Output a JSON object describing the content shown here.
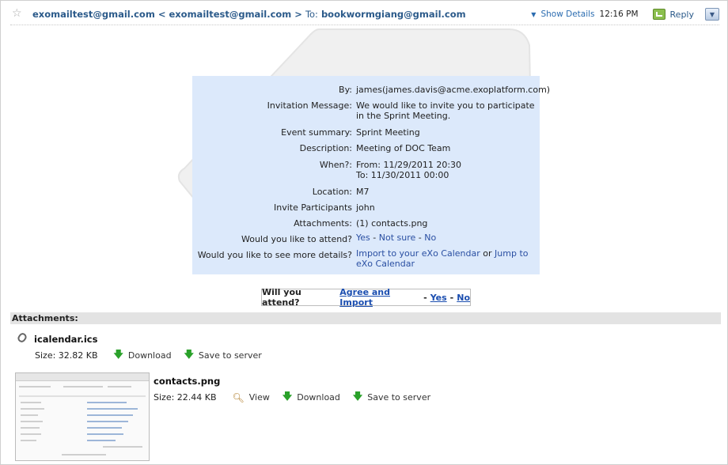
{
  "header": {
    "from": "exomailtest@gmail.com < exomailtest@gmail.com >",
    "to_label": "To:",
    "to": "bookwormgiang@gmail.com",
    "show_details": "Show Details",
    "time": "12:16 PM",
    "reply": "Reply"
  },
  "invite": {
    "rows": [
      {
        "label": "By:",
        "value": "james(james.davis@acme.exoplatform.com)"
      },
      {
        "label": "Invitation Message:",
        "value": "We would like to invite you to participate in the Sprint Meeting."
      },
      {
        "label": "Event summary:",
        "value": "Sprint Meeting"
      },
      {
        "label": "Description:",
        "value": "Meeting of DOC Team"
      },
      {
        "label": "When?:",
        "value": "From: 11/29/2011 20:30",
        "value2": "To: 11/30/2011 00:00"
      },
      {
        "label": "Location:",
        "value": "M7"
      },
      {
        "label": "Invite Participants",
        "value": "john"
      },
      {
        "label": "Attachments:",
        "value": "(1) contacts.png"
      }
    ],
    "attend_label": "Would you like to attend?",
    "attend_yes": "Yes",
    "attend_sep1": " - ",
    "attend_notsure": "Not sure",
    "attend_sep2": " - ",
    "attend_no": "No",
    "details_label": "Would you like to see more details?",
    "details_import": "Import to your eXo Calendar",
    "details_or": " or ",
    "details_jump": "Jump to eXo Calendar"
  },
  "attend_box": {
    "question": "Will you attend?",
    "agree": "Agree and Import",
    "sep1": "-",
    "yes": "Yes",
    "sep2": "-",
    "no": "No"
  },
  "attachments": {
    "title": "Attachments:",
    "files": [
      {
        "name": "icalendar.ics",
        "size": "Size: 32.82 KB",
        "download": "Download",
        "save": "Save to server"
      },
      {
        "name": "contacts.png",
        "size": "Size: 22.44 KB",
        "view": "View",
        "download": "Download",
        "save": "Save to server"
      }
    ]
  }
}
